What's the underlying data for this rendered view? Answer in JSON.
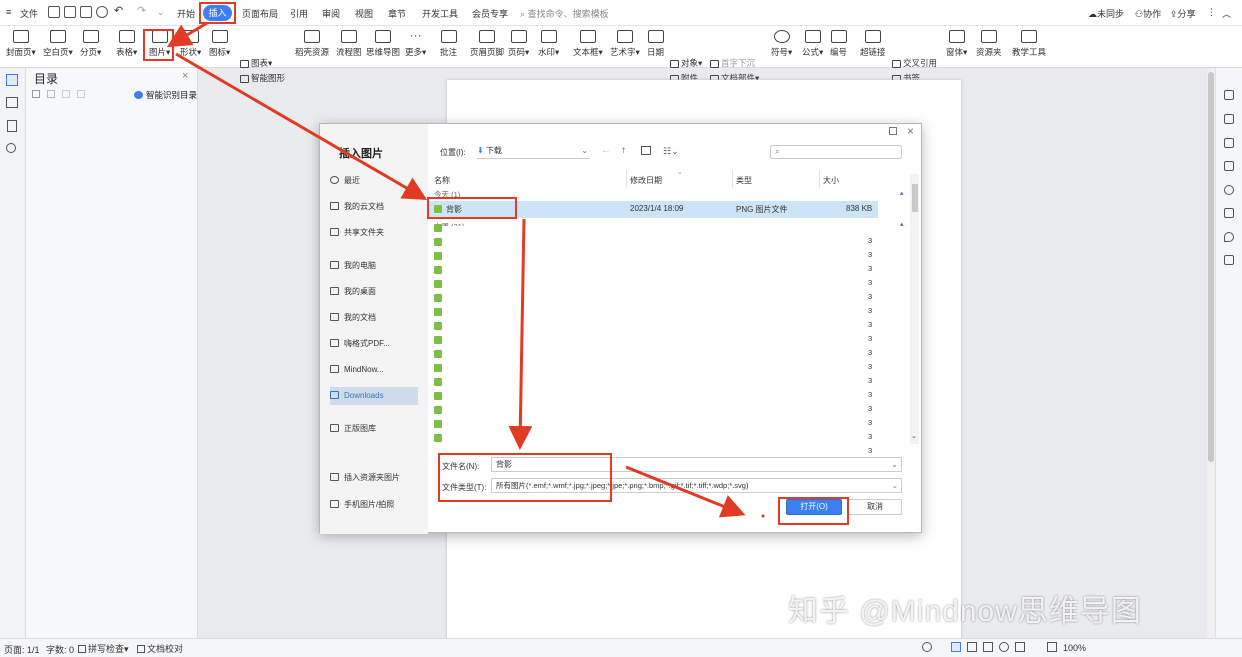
{
  "menubar": {
    "file": "文件",
    "tabs": [
      "开始",
      "插入",
      "页面布局",
      "引用",
      "审阅",
      "视图",
      "章节",
      "开发工具",
      "会员专享"
    ],
    "active_tab": "插入",
    "search_placeholder": "查找命令、搜索模板",
    "sync": "未同步",
    "collab": "协作",
    "share": "分享"
  },
  "ribbon": {
    "cover": "封面页",
    "blank": "空白页",
    "pagebreak": "分页",
    "table": "表格",
    "picture": "图片",
    "shape": "形状",
    "icon": "图标",
    "chart": "图表",
    "smartart": "智能图形",
    "material": "稻壳资源",
    "flow": "流程图",
    "mind": "思维导图",
    "more": "更多",
    "comment": "批注",
    "headerfooter": "页眉页脚",
    "pagenum": "页码",
    "watermark": "水印",
    "textbox": "文本框",
    "wordart": "艺术字",
    "date": "日期",
    "object": "对象",
    "attach": "附件",
    "dropcap": "首字下沉",
    "docpart": "文档部件",
    "symbol": "符号",
    "formula": "公式",
    "numbering": "编号",
    "hyperlink": "超链接",
    "crossref": "交叉引用",
    "bookmark": "书签",
    "form": "窗体",
    "resource": "资源夹",
    "teach": "教学工具"
  },
  "toc": {
    "title": "目录",
    "smart": "智能识别目录"
  },
  "dialog": {
    "title": "插入图片",
    "location_label": "位置(I):",
    "location_value": "下载",
    "search_placeholder": "",
    "sidebar": [
      "最近",
      "我的云文档",
      "共享文件夹",
      "我的电脑",
      "我的桌面",
      "我的文档",
      "嗨格式PDF...",
      "MindNow...",
      "Downloads",
      "正版图库",
      "插入资源夹图片",
      "手机图片/拍照"
    ],
    "selected_sidebar": "Downloads",
    "columns": [
      "名称",
      "修改日期",
      "类型",
      "大小"
    ],
    "group_today": "今天 (1)",
    "group_earlier": "上周 (21)",
    "selected_file": {
      "name": "背影",
      "date": "2023/1/4 18:09",
      "type": "PNG 图片文件",
      "size": "838 KB"
    },
    "truncated_size": "3",
    "filename_label": "文件名(N):",
    "filename_value": "背影",
    "filetype_label": "文件类型(T):",
    "filetype_value": "所有图片(*.emf;*.wmf;*.jpg;*.jpeg;*.jpe;*.png;*.bmp;*.gif;*.tif;*.tiff;*.wdp;*.svg)",
    "open_button": "打开(O)",
    "cancel_button": "取消"
  },
  "status": {
    "page": "页面: 1/1",
    "words": "字数: 0",
    "spell": "拼写检查",
    "proof": "文档校对",
    "zoom": "100%"
  },
  "watermark": "知乎 @Mindnow思维导图",
  "colors": {
    "accent": "#3b7ff0",
    "annotation": "#e23b24",
    "selection": "#cce4f7"
  }
}
